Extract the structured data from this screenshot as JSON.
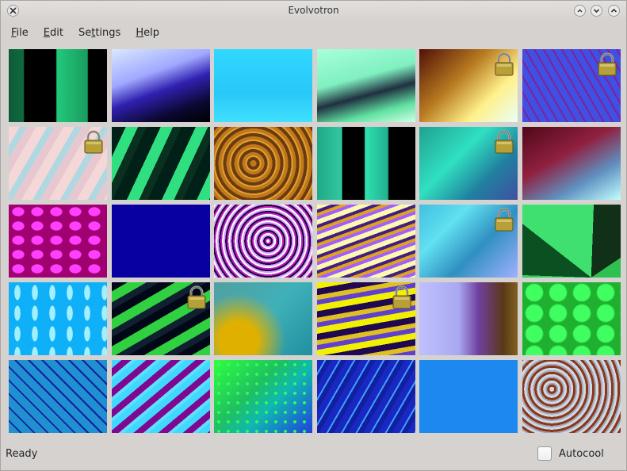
{
  "window": {
    "title": "Evolvotron"
  },
  "menu": [
    {
      "mnemonic": "F",
      "rest": "ile"
    },
    {
      "mnemonic": "E",
      "rest": "dit"
    },
    {
      "pre": "Se",
      "mnemonic": "t",
      "rest": "tings"
    },
    {
      "mnemonic": "H",
      "rest": "elp"
    }
  ],
  "status": {
    "text": "Ready",
    "autocool_label": "Autocool",
    "autocool_checked": false
  },
  "images": [
    {
      "locked": false,
      "desc": "green-black-stripes"
    },
    {
      "locked": false,
      "desc": "white-purple-spikes"
    },
    {
      "locked": false,
      "desc": "cyan-cracks"
    },
    {
      "locked": false,
      "desc": "mint-dark-spikes"
    },
    {
      "locked": true,
      "desc": "brown-yellow-burst"
    },
    {
      "locked": true,
      "desc": "blue-hex-mesh"
    },
    {
      "locked": true,
      "desc": "pink-pastel-diagonals"
    },
    {
      "locked": false,
      "desc": "green-navy-diagonals"
    },
    {
      "locked": false,
      "desc": "brown-orange-noise"
    },
    {
      "locked": false,
      "desc": "teal-black-stripes"
    },
    {
      "locked": true,
      "desc": "teal-hex-cells"
    },
    {
      "locked": false,
      "desc": "maroon-cyan-burst"
    },
    {
      "locked": false,
      "desc": "magenta-spots"
    },
    {
      "locked": false,
      "desc": "solid-navy"
    },
    {
      "locked": false,
      "desc": "psychedelic-swirl"
    },
    {
      "locked": false,
      "desc": "yellow-purple-zigzag"
    },
    {
      "locked": true,
      "desc": "cyan-shards"
    },
    {
      "locked": false,
      "desc": "green-fan"
    },
    {
      "locked": false,
      "desc": "sky-blue-drops"
    },
    {
      "locked": true,
      "desc": "green-black-streaks"
    },
    {
      "locked": false,
      "desc": "teal-gold-blur"
    },
    {
      "locked": true,
      "desc": "yellow-navy-waves"
    },
    {
      "locked": false,
      "desc": "lavender-brown-spikes"
    },
    {
      "locked": false,
      "desc": "green-hexagons"
    },
    {
      "locked": false,
      "desc": "blue-square-mesh"
    },
    {
      "locked": false,
      "desc": "purple-cyan-streaks"
    },
    {
      "locked": false,
      "desc": "green-dots-gradient"
    },
    {
      "locked": false,
      "desc": "blue-arrows"
    },
    {
      "locked": false,
      "desc": "solid-azure"
    },
    {
      "locked": false,
      "desc": "brown-marble"
    }
  ],
  "icons": {
    "close": "close-icon",
    "minimize": "minimize-icon",
    "maximize": "maximize-icon",
    "restore": "restore-icon",
    "lock": "padlock-icon"
  }
}
